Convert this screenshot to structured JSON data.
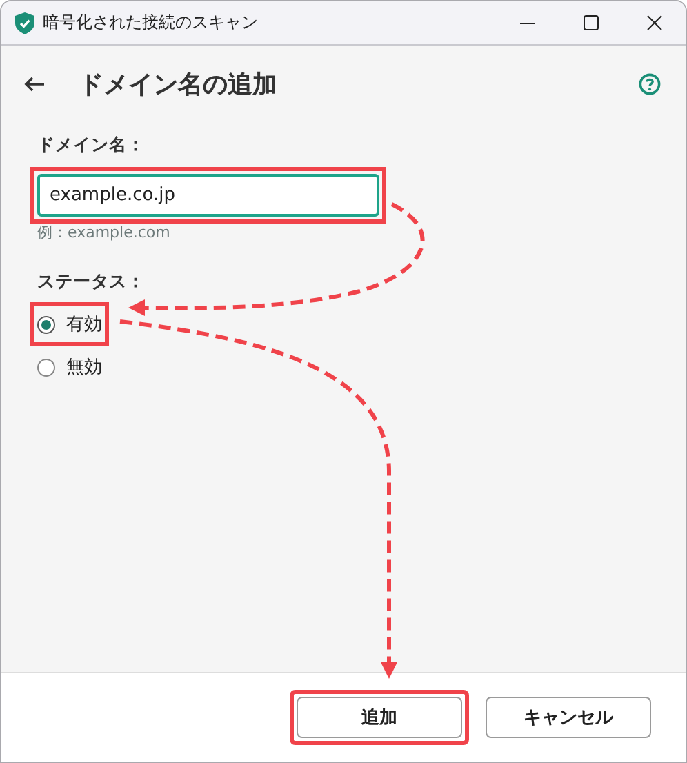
{
  "window": {
    "title": "暗号化された接続のスキャン"
  },
  "header": {
    "title": "ドメイン名の追加"
  },
  "domain": {
    "label": "ドメイン名：",
    "value": "example.co.jp",
    "hint": "例：example.com",
    "highlighted": true
  },
  "status": {
    "label": "ステータス：",
    "options": [
      {
        "label": "有効",
        "selected": true,
        "highlighted": true
      },
      {
        "label": "無効",
        "selected": false,
        "highlighted": false
      }
    ]
  },
  "buttons": [
    {
      "label": "追加",
      "highlighted": true
    },
    {
      "label": "キャンセル",
      "highlighted": false
    }
  ]
}
